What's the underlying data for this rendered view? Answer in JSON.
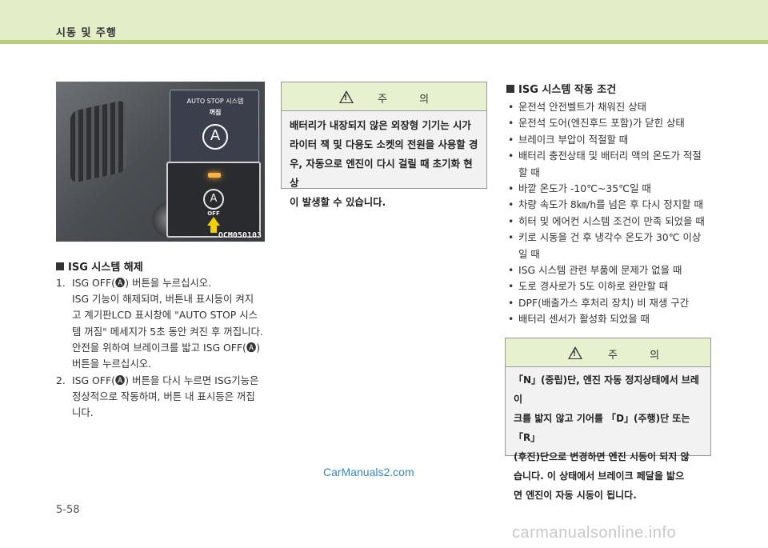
{
  "header": {
    "title": "시동 및 주행"
  },
  "figure": {
    "panel_title": "AUTO STOP 시스템",
    "panel_sub": "꺼짐",
    "panel_symbol": "A",
    "button_symbol": "A",
    "button_label": "OFF",
    "code": "OCM050103"
  },
  "isg_release": {
    "heading": "ISG 시스템 해제",
    "steps": [
      {
        "num": "1.",
        "lines": [
          "ISG OFF(🅐) 버튼을 누르십시오.",
          "ISG 기능이 해제되며, 버튼내 표시등이 켜지",
          "고 계기판LCD 표시창에 \"AUTO STOP 시스",
          "템 꺼짐\" 메세지가 5초 동안 켜진 후 꺼집니다.",
          "안전을 위하여 브레이크를 밟고 ISG OFF(🅐)",
          "버튼을 누르십시오."
        ]
      },
      {
        "num": "2.",
        "lines": [
          "ISG OFF(🅐) 버튼을 다시 누르면 ISG기능은",
          "정상적으로 작동하며, 버튼 내 표시등은 꺼집",
          "니다."
        ]
      }
    ]
  },
  "caution1": {
    "label": "주 의",
    "lines": [
      "배터리가 내장되지 않은 외장형 기기는 시가",
      "라이터 잭 및 다용도 소켓의 전원을 사용할 경",
      "우, 자동으로 엔진이 다시 걸릴 때 초기화 현상",
      "이 발생할 수 있습니다."
    ]
  },
  "isg_conditions": {
    "heading": "ISG 시스템 작동 조건",
    "items": [
      "운전석 안전벨트가 채워진 상태",
      "운전석 도어(엔진후드 포함)가 닫힌 상태",
      "브레이크 부압이 적절할 때",
      "배터리 충전상태 및 배터리 액의 온도가 적절 할 때",
      "바깥 온도가 -10℃~35℃일 때",
      "차량 속도가 8㎞/h를 넘은 후 다시 정지할 때",
      "히터 및 에어컨 시스템 조건이 만족 되었을 때",
      "키로 시동을 건 후 냉각수 온도가 30℃ 이상 일 때",
      "ISG 시스템 관련 부품에 문제가 없을 때",
      "도로 경사로가 5도 이하로 완만할 때",
      "DPF(배출가스 후처리 장치) 비 재생 구간",
      "배터리 센서가 활성화 되었을 때"
    ]
  },
  "caution2": {
    "label": "주 의",
    "lines": [
      "「N」(중립)단, 엔진 자동 정지상태에서 브레이",
      "크를 밟지 않고 기어를 「D」(주행)단 또는 「R」",
      "(후진)단으로 변경하면 엔진 시동이 되지 않",
      "습니다. 이 상태에서 브레이크 페달을 밟으",
      "면 엔진이 자동 시동이 됩니다."
    ]
  },
  "footer": {
    "watermark": "CarManuals2.com",
    "page_number": "5-58",
    "site_mark": "carmanualsonline.info"
  }
}
